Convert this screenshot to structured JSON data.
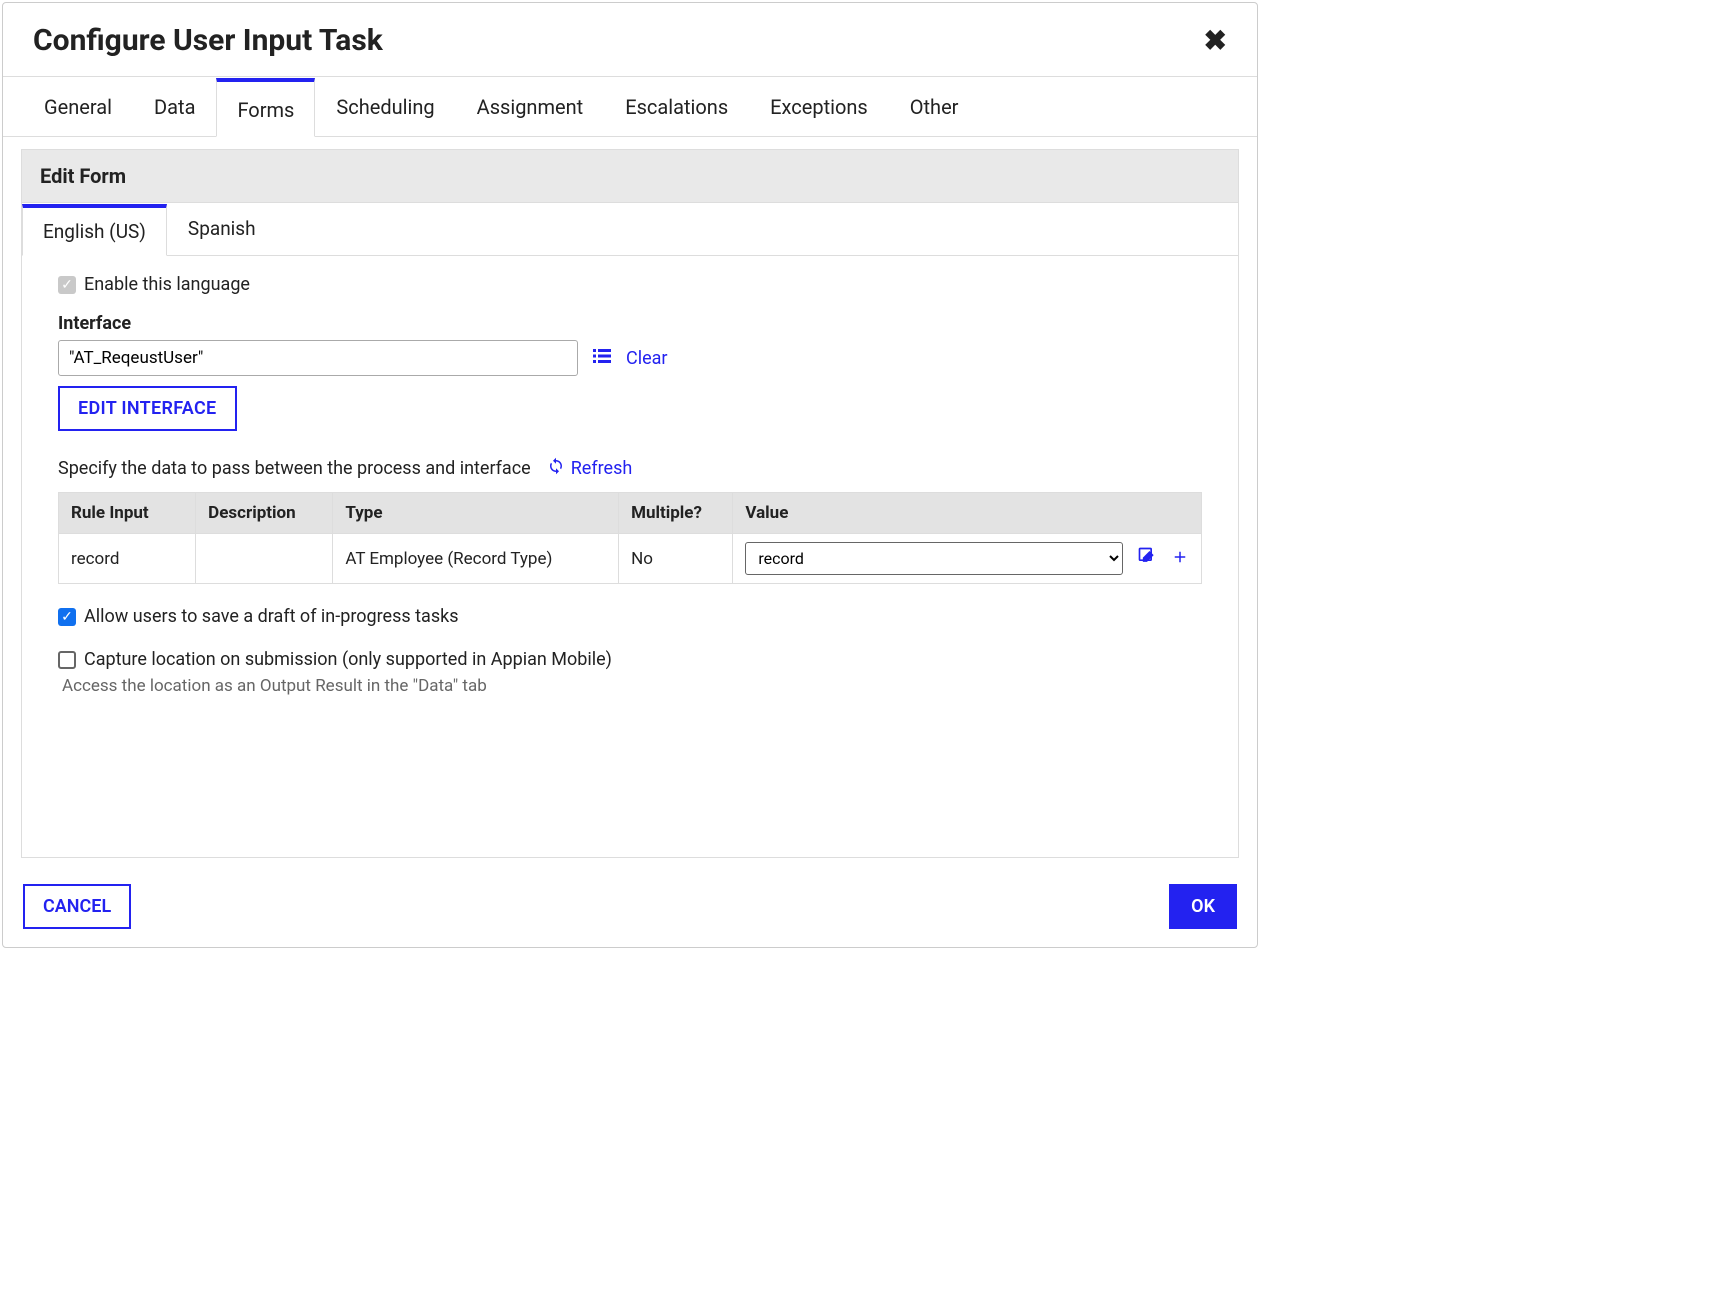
{
  "dialog": {
    "title": "Configure User Input Task"
  },
  "mainTabs": [
    {
      "label": "General"
    },
    {
      "label": "Data"
    },
    {
      "label": "Forms",
      "active": true
    },
    {
      "label": "Scheduling"
    },
    {
      "label": "Assignment"
    },
    {
      "label": "Escalations"
    },
    {
      "label": "Exceptions"
    },
    {
      "label": "Other"
    }
  ],
  "panel": {
    "title": "Edit Form"
  },
  "langTabs": [
    {
      "label": "English (US)",
      "active": true
    },
    {
      "label": "Spanish"
    }
  ],
  "enableLanguage": {
    "label": "Enable this language",
    "checked": true
  },
  "interfaceSection": {
    "label": "Interface",
    "value": "\"AT_ReqeustUser\"",
    "clearLabel": "Clear",
    "editButton": "EDIT INTERFACE"
  },
  "dataPass": {
    "instruction": "Specify the data to pass between the process and interface",
    "refreshLabel": "Refresh"
  },
  "table": {
    "headers": {
      "ruleInput": "Rule Input",
      "description": "Description",
      "type": "Type",
      "multiple": "Multiple?",
      "value": "Value"
    },
    "rows": [
      {
        "ruleInput": "record",
        "description": "",
        "type": "AT Employee (Record Type)",
        "multiple": "No",
        "value": "record"
      }
    ]
  },
  "allowDraft": {
    "label": "Allow users to save a draft of in-progress tasks",
    "checked": true
  },
  "captureLocation": {
    "label": "Capture location on submission (only supported in Appian Mobile)",
    "checked": false,
    "helper": "Access the location as an Output Result in the \"Data\" tab"
  },
  "footer": {
    "cancel": "CANCEL",
    "ok": "OK"
  }
}
